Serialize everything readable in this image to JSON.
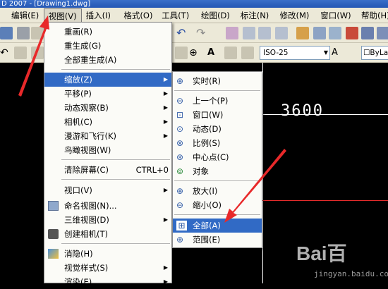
{
  "window": {
    "title": "D 2007 - [Drawing1.dwg]"
  },
  "menubar": [
    {
      "label": "编辑(E)"
    },
    {
      "label": "视图(V)"
    },
    {
      "label": "插入(I)"
    },
    {
      "label": "格式(O)"
    },
    {
      "label": "工具(T)"
    },
    {
      "label": "绘图(D)"
    },
    {
      "label": "标注(N)"
    },
    {
      "label": "修改(M)"
    },
    {
      "label": "窗口(W)"
    },
    {
      "label": "帮助(H)"
    }
  ],
  "toolbar": {
    "textstyle_value": "ISO-25",
    "layer_value": "ByLa"
  },
  "canvas": {
    "dimension_text": "3600"
  },
  "view_menu": {
    "items": [
      {
        "label": "重画(R)"
      },
      {
        "label": "重生成(G)"
      },
      {
        "label": "全部重生成(A)"
      },
      {
        "label": "缩放(Z)"
      },
      {
        "label": "平移(P)"
      },
      {
        "label": "动态观察(B)"
      },
      {
        "label": "相机(C)"
      },
      {
        "label": "漫游和飞行(K)"
      },
      {
        "label": "鸟瞰视图(W)"
      },
      {
        "label": "清除屏幕(C)",
        "shortcut": "CTRL+0"
      },
      {
        "label": "视口(V)"
      },
      {
        "label": "命名视图(N)..."
      },
      {
        "label": "三维视图(D)"
      },
      {
        "label": "创建相机(T)"
      },
      {
        "label": "消隐(H)"
      },
      {
        "label": "视觉样式(S)"
      },
      {
        "label": "渲染(E)"
      }
    ]
  },
  "zoom_submenu": {
    "items": [
      {
        "label": "实时(R)"
      },
      {
        "label": "上一个(P)"
      },
      {
        "label": "窗口(W)"
      },
      {
        "label": "动态(D)"
      },
      {
        "label": "比例(S)"
      },
      {
        "label": "中心点(C)"
      },
      {
        "label": "对象"
      },
      {
        "label": "放大(I)"
      },
      {
        "label": "缩小(O)"
      },
      {
        "label": "全部(A)"
      },
      {
        "label": "范围(E)"
      }
    ]
  },
  "watermark": {
    "site": "jingyan.baidu.com"
  }
}
